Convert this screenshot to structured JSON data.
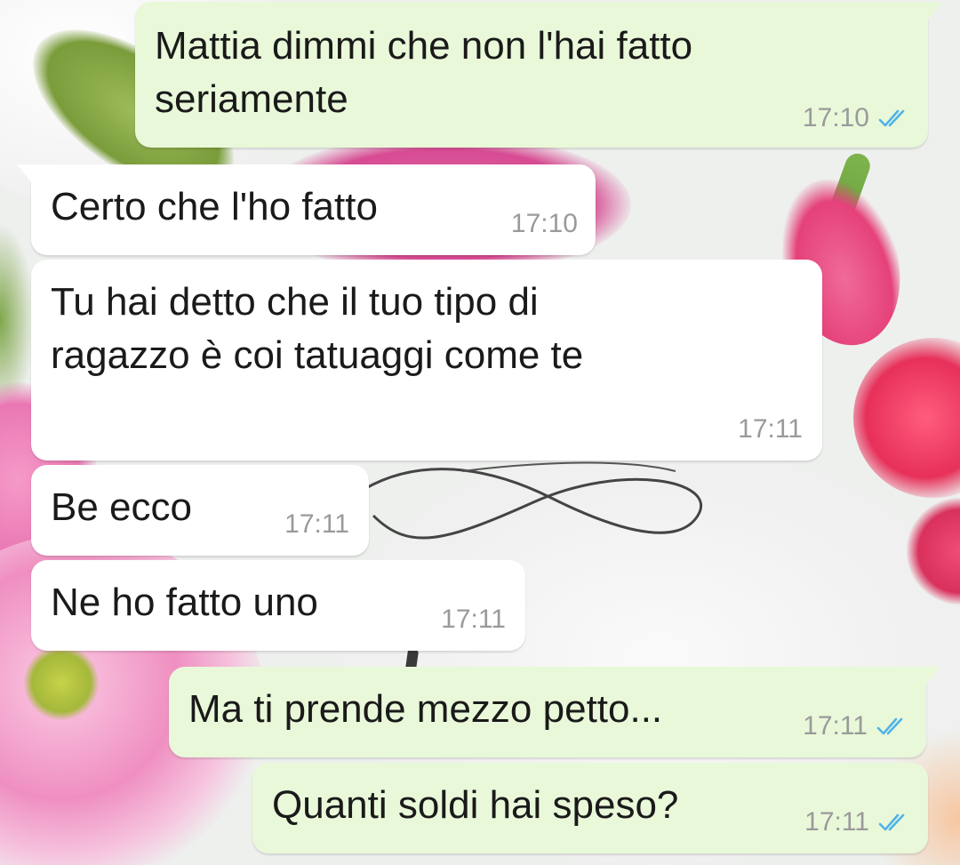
{
  "messages": [
    {
      "direction": "outgoing",
      "text": "Mattia dimmi che non l'hai fatto\nseriamente",
      "time": "17:10",
      "status_icon": "double-check-read-icon"
    },
    {
      "direction": "incoming",
      "text": "Certo che l'ho fatto",
      "time": "17:10"
    },
    {
      "direction": "incoming",
      "text": "Tu hai detto che il tuo tipo di\nragazzo è coi tatuaggi come te",
      "time": "17:11"
    },
    {
      "direction": "incoming",
      "text": "Be ecco",
      "time": "17:11"
    },
    {
      "direction": "incoming",
      "text": "Ne ho fatto uno",
      "time": "17:11"
    },
    {
      "direction": "outgoing",
      "text": "Ma ti prende mezzo petto...",
      "time": "17:11",
      "status_icon": "double-check-read-icon"
    },
    {
      "direction": "outgoing",
      "text": "Quanti soldi hai speso?",
      "time": "17:11",
      "status_icon": "double-check-read-icon"
    }
  ],
  "colors": {
    "outgoing_bubble": "#e9f8d9",
    "incoming_bubble": "#ffffff",
    "read_tick": "#4fb3e8",
    "timestamp": "#9a9a9a"
  }
}
